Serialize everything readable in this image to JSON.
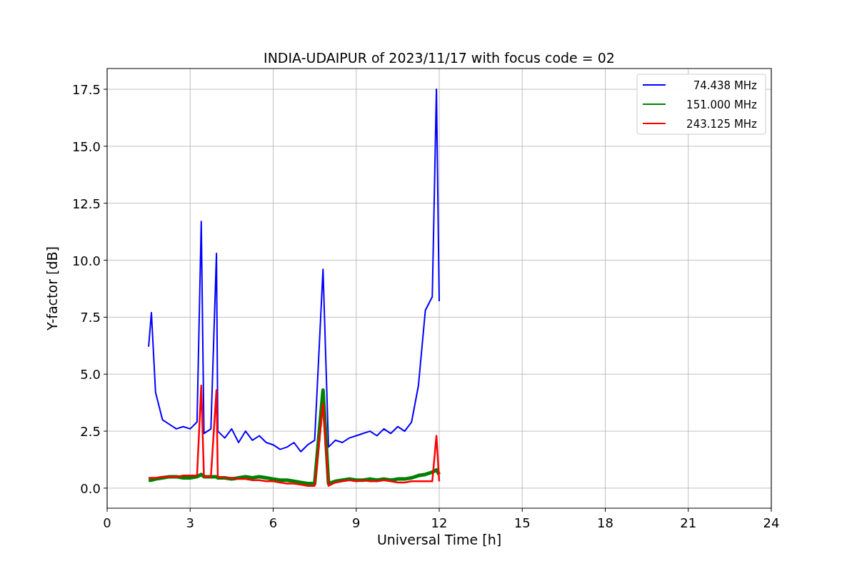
{
  "figure": {
    "chart_data": {
      "type": "line",
      "title": "INDIA-UDAIPUR of 2023/11/17 with focus code = 02",
      "xlabel": "Universal Time [h]",
      "ylabel": "Y-factor [dB]",
      "x": [
        1.5,
        1.6,
        1.75,
        2.0,
        2.25,
        2.5,
        2.75,
        3.0,
        3.25,
        3.4,
        3.5,
        3.75,
        3.95,
        4.0,
        4.25,
        4.5,
        4.75,
        5.0,
        5.25,
        5.5,
        5.75,
        6.0,
        6.25,
        6.5,
        6.75,
        7.0,
        7.25,
        7.5,
        7.8,
        8.0,
        8.25,
        8.5,
        8.75,
        9.0,
        9.25,
        9.5,
        9.75,
        10.0,
        10.25,
        10.5,
        10.75,
        11.0,
        11.25,
        11.5,
        11.75,
        11.9,
        12.0
      ],
      "series": [
        {
          "name": "74.438 MHz",
          "color": "#0000ff",
          "values": [
            6.2,
            7.7,
            4.2,
            3.0,
            2.8,
            2.6,
            2.7,
            2.6,
            2.9,
            11.7,
            2.4,
            2.6,
            10.3,
            2.5,
            2.2,
            2.6,
            2.0,
            2.5,
            2.1,
            2.3,
            2.0,
            1.9,
            1.7,
            1.8,
            2.0,
            1.6,
            1.9,
            2.1,
            9.6,
            1.8,
            2.1,
            2.0,
            2.2,
            2.3,
            2.4,
            2.5,
            2.3,
            2.6,
            2.4,
            2.7,
            2.5,
            2.9,
            4.5,
            7.8,
            8.4,
            17.5,
            8.2
          ]
        },
        {
          "name": "151.000 MHz",
          "color": "#008000",
          "values": [
            0.35,
            0.35,
            0.4,
            0.45,
            0.5,
            0.5,
            0.45,
            0.45,
            0.5,
            0.6,
            0.5,
            0.5,
            0.5,
            0.45,
            0.45,
            0.4,
            0.45,
            0.5,
            0.45,
            0.5,
            0.45,
            0.4,
            0.35,
            0.35,
            0.3,
            0.25,
            0.2,
            0.2,
            4.3,
            0.2,
            0.3,
            0.35,
            0.4,
            0.35,
            0.35,
            0.4,
            0.35,
            0.4,
            0.35,
            0.4,
            0.4,
            0.45,
            0.55,
            0.6,
            0.7,
            0.8,
            0.6
          ]
        },
        {
          "name": "243.125 MHz",
          "color": "#ff0000",
          "values": [
            0.45,
            0.45,
            0.45,
            0.5,
            0.5,
            0.5,
            0.55,
            0.55,
            0.55,
            4.5,
            0.5,
            0.5,
            4.3,
            0.5,
            0.45,
            0.45,
            0.4,
            0.4,
            0.35,
            0.35,
            0.3,
            0.3,
            0.25,
            0.2,
            0.2,
            0.15,
            0.1,
            0.1,
            3.7,
            0.1,
            0.25,
            0.3,
            0.35,
            0.3,
            0.35,
            0.3,
            0.3,
            0.35,
            0.3,
            0.25,
            0.25,
            0.3,
            0.3,
            0.3,
            0.3,
            2.3,
            0.3
          ]
        }
      ],
      "grid": true,
      "legend": true,
      "xlim": [
        0,
        24
      ],
      "ylim": [
        -0.88,
        18.41
      ],
      "xticks": [
        0,
        3,
        6,
        9,
        12,
        15,
        18,
        21,
        24
      ],
      "yticks": [
        {
          "value": 0,
          "label": "0.0"
        },
        {
          "value": 2.5,
          "label": "2.5"
        },
        {
          "value": 5,
          "label": "5.0"
        },
        {
          "value": 7.5,
          "label": "7.5"
        },
        {
          "value": 10,
          "label": "10.0"
        },
        {
          "value": 12.5,
          "label": "12.5"
        },
        {
          "value": 15,
          "label": "15.0"
        },
        {
          "value": 17.5,
          "label": "17.5"
        }
      ]
    }
  }
}
